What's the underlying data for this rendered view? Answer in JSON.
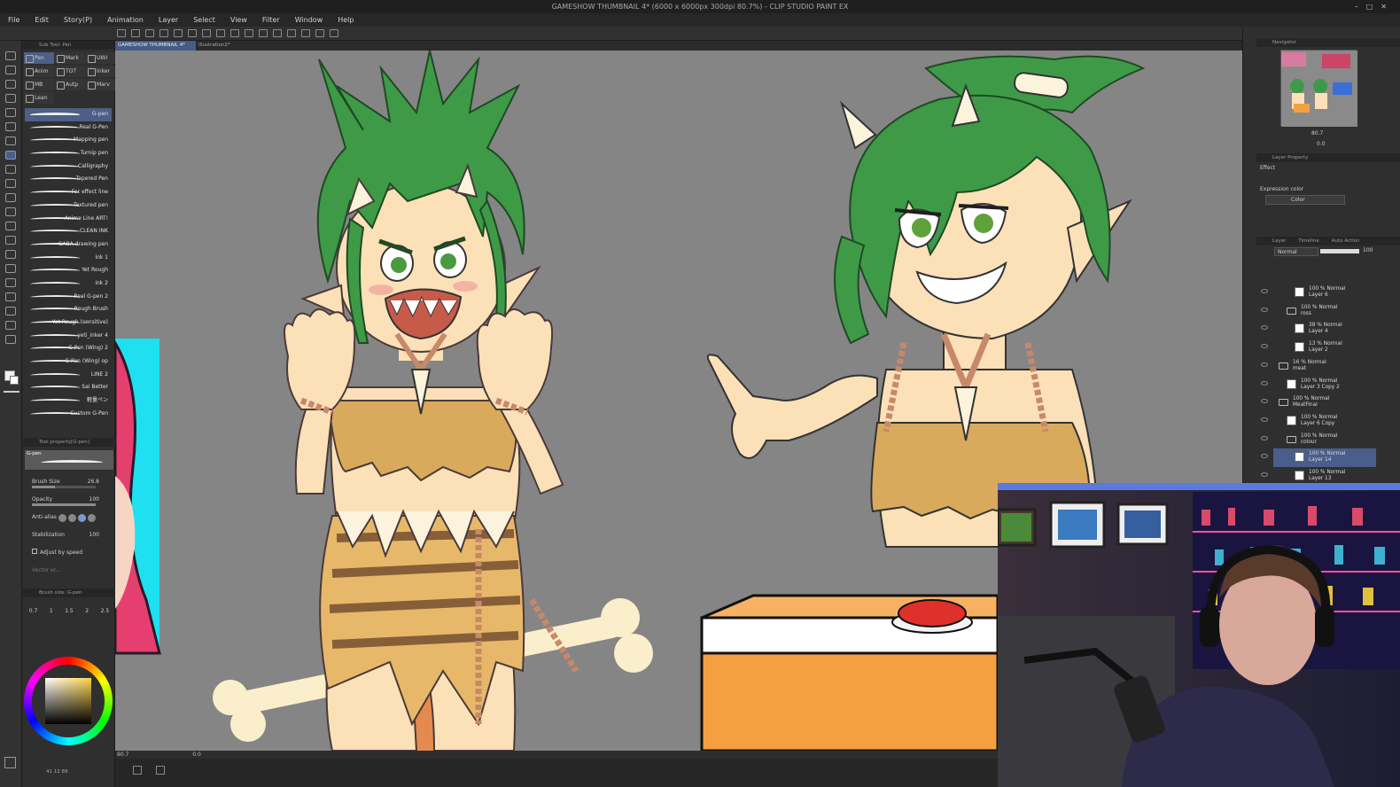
{
  "title_bar": {
    "title": "GAMESHOW THUMBNAIL 4* (6000 x 6000px 300dpi 80.7%) - CLIP STUDIO PAINT EX"
  },
  "menu": [
    "File",
    "Edit",
    "Story(P)",
    "Animation",
    "Layer",
    "Select",
    "View",
    "Filter",
    "Window",
    "Help"
  ],
  "sub_tool": {
    "header": "Sub Tool: Pen",
    "groups": [
      "Pen",
      "Mark",
      "UWI",
      "Anim",
      "TOT",
      "Inker",
      "MB",
      "Autp",
      "Marv",
      "Lean"
    ],
    "brushes": [
      "G-pen",
      "Real G-Pen",
      "Mapping pen",
      "Turnip pen",
      "Calligraphy",
      "Tapered Pen",
      "For effect line",
      "Textured pen",
      "Anime Line ART!",
      "CLEAN INK",
      "GABA drawing pen",
      "ink 1",
      "Yet Rough",
      "ink 2",
      "Real G-pen 2",
      "Rough Brush",
      "Yet Rough (sensitive)",
      "yeti_inker 4",
      "G Pen (Wing) 2",
      "G Pen (Wing) op",
      "LINE 2",
      "Sai Better",
      "軽量ペン",
      "Custom G-Pen"
    ]
  },
  "tool_property": {
    "header": "Tool property[G-pen]",
    "preview_label": "G-pen",
    "brush_size_label": "Brush Size",
    "brush_size_value": "26.8",
    "opacity_label": "Opacity",
    "opacity_value": "100",
    "opacity_fraction": 1.0,
    "antialias_label": "Anti-alias",
    "stabilization_label": "Stabilization",
    "stabilization_value": "100",
    "adjust_by_speed_label": "Adjust by speed",
    "vector_label": "Vector er..."
  },
  "brush_size_panel": {
    "header": "Brush size: G-pen",
    "sizes": [
      "0.7",
      "1",
      "1.5",
      "2",
      "2.5"
    ]
  },
  "document_tabs": [
    "GAMESHOW THUMBNAIL 4*",
    "Illustration2*"
  ],
  "status": {
    "zoom": "80.7",
    "angle": "0.0"
  },
  "bottom_left": {
    "coords": "41   12   89"
  },
  "navigator": {
    "header": "Navigator",
    "zoom": "80.7",
    "angle": "0.0"
  },
  "layer_property": {
    "header": "Layer Property",
    "effect_label": "Effect",
    "expression_color_label": "Expression color",
    "expression_color_value": "Color"
  },
  "layer_panel": {
    "tabs": [
      "Layer",
      "Timeline",
      "Auto Action"
    ],
    "blend_mode": "Normal",
    "opacity": "100",
    "layers": [
      {
        "opacity": "100 %",
        "mode": "Normal",
        "name": "Layer 6",
        "indent": 2,
        "folder": false
      },
      {
        "opacity": "100 %",
        "mode": "Normal",
        "name": "ross",
        "indent": 1,
        "folder": true
      },
      {
        "opacity": "38 %",
        "mode": "Normal",
        "name": "Layer 4",
        "indent": 2,
        "folder": false
      },
      {
        "opacity": "13 %",
        "mode": "Normal",
        "name": "Layer 2",
        "indent": 2,
        "folder": false
      },
      {
        "opacity": "16 %",
        "mode": "Normal",
        "name": "meat",
        "indent": 0,
        "folder": true
      },
      {
        "opacity": "100 %",
        "mode": "Normal",
        "name": "Layer 3 Copy 2",
        "indent": 1,
        "folder": false
      },
      {
        "opacity": "100 %",
        "mode": "Normal",
        "name": "MeatFinal",
        "indent": 0,
        "folder": true
      },
      {
        "opacity": "100 %",
        "mode": "Normal",
        "name": "Layer 6 Copy",
        "indent": 1,
        "folder": false
      },
      {
        "opacity": "100 %",
        "mode": "Normal",
        "name": "colour",
        "indent": 1,
        "folder": true
      },
      {
        "opacity": "100 %",
        "mode": "Normal",
        "name": "Layer 14",
        "indent": 2,
        "folder": false,
        "selected": true
      },
      {
        "opacity": "100 %",
        "mode": "Normal",
        "name": "Layer 13",
        "indent": 2,
        "folder": false
      }
    ]
  },
  "colors": {
    "accent": "#4d5f86",
    "canvas_bg": "#858585",
    "hair": "#3e9a47",
    "skin": "#fbe0b8",
    "outfit": "#d9a95c",
    "podium": "#f5a040",
    "buzzer": "#e0302a"
  }
}
